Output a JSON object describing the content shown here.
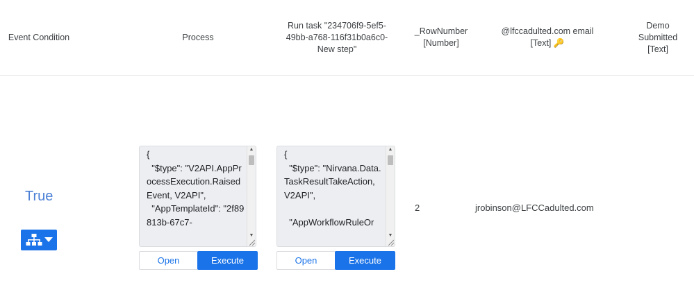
{
  "headers": {
    "event_condition": "Event Condition",
    "process": "Process",
    "run_task": [
      "Run task \"234706f9-5ef5-",
      "49bb-a768-116f31b0a6c0-",
      "New step\""
    ],
    "row_number": [
      "_RowNumber",
      "[Number]"
    ],
    "email": [
      "@lfccadulted.com email",
      "[Text] 🔑"
    ],
    "demo": [
      "Demo",
      "Submitted",
      "[Text]"
    ]
  },
  "row": {
    "condition_value": "True",
    "tree_button_icon": "sitemap-icon",
    "process_json": "{\n  \"$type\": \"V2API.AppProcessExecution.RaisedEvent, V2API\",\n  \"AppTemplateId\": \"2f89813b-67c7-",
    "run_task_json": "{\n  \"$type\": \"Nirvana.Data.TaskResultTakeAction, V2API\",\n\n  \"AppWorkflowRuleOr",
    "open_label": "Open",
    "execute_label": "Execute",
    "row_number": "2",
    "email": "jrobinson@LFCCadulted.com"
  },
  "colors": {
    "accent": "#1a73e8",
    "true_text": "#4a7fd6",
    "codebox_bg": "#eceef1"
  }
}
